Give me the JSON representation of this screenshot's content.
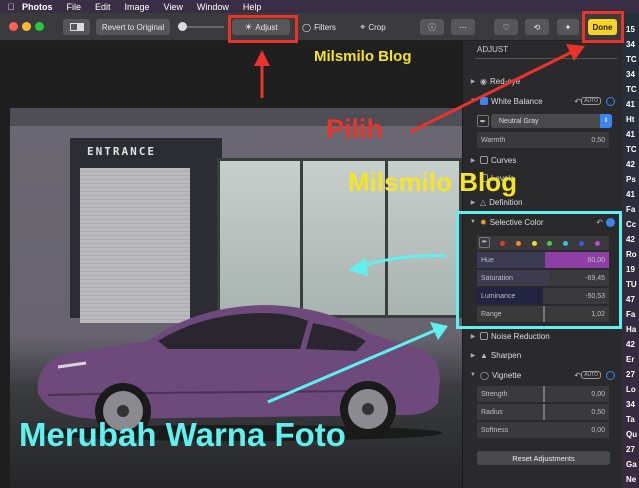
{
  "menubar": {
    "app": "Photos",
    "items": [
      "File",
      "Edit",
      "Image",
      "View",
      "Window",
      "Help"
    ]
  },
  "toolbar": {
    "revert_label": "Revert to Original",
    "adjust_label": "Adjust",
    "filters_label": "Filters",
    "crop_label": "Crop",
    "done_label": "Done"
  },
  "photo": {
    "sign_text": "ENTRANCE"
  },
  "annotations": {
    "blog_top": "Milsmilo Blog",
    "blog_mid": "Milsmilo Blog",
    "pilih": "Pilih",
    "caption": "Merubah Warna Foto"
  },
  "panel": {
    "title": "ADJUST",
    "red_eye": "Red-eye",
    "white_balance": "White Balance",
    "wb_dropdown": "Neutral Gray",
    "warmth_label": "Warmth",
    "warmth_value": "0,50",
    "curves": "Curves",
    "levels": "Levels",
    "definition": "Definition",
    "selective_color": "Selective Color",
    "hue_label": "Hue",
    "hue_value": "60,00",
    "saturation_label": "Saturation",
    "saturation_value": "-69,45",
    "luminance_label": "Luminance",
    "luminance_value": "-50,53",
    "range_label": "Range",
    "range_value": "1,02",
    "noise_reduction": "Noise Reduction",
    "sharpen": "Sharpen",
    "vignette": "Vignette",
    "strength_label": "Strength",
    "strength_value": "0,00",
    "radius_label": "Radius",
    "radius_value": "0,50",
    "softness_label": "Softness",
    "softness_value": "0,00",
    "auto_badge": "AUTO",
    "reset_label": "Reset Adjustments"
  },
  "edge_labels": [
    "15",
    "34",
    "TC",
    "34",
    "TC",
    "41",
    "Ht",
    "41",
    "TC",
    "42",
    "Ps",
    "41",
    "Fa",
    "Cc",
    "42",
    "Ro",
    "19",
    "TU",
    "47",
    "Fa",
    "Ha",
    "42",
    "Er",
    "27",
    "Lo",
    "34",
    "Ta",
    "Qu",
    "27",
    "Ga",
    "Ne"
  ],
  "colors": {
    "accent_red": "#e8342a",
    "accent_cyan": "#5ff1ef",
    "accent_yellow": "#f5e526",
    "car_purple": "#6e4a7c",
    "hue_fill": "#8e3fa6",
    "macos_blue": "#3c86f0"
  },
  "swatch_colors": [
    "#e33b3b",
    "#f08a24",
    "#e8e02c",
    "#52c93f",
    "#2ec6d8",
    "#3a5bdf",
    "#b84bd6"
  ]
}
